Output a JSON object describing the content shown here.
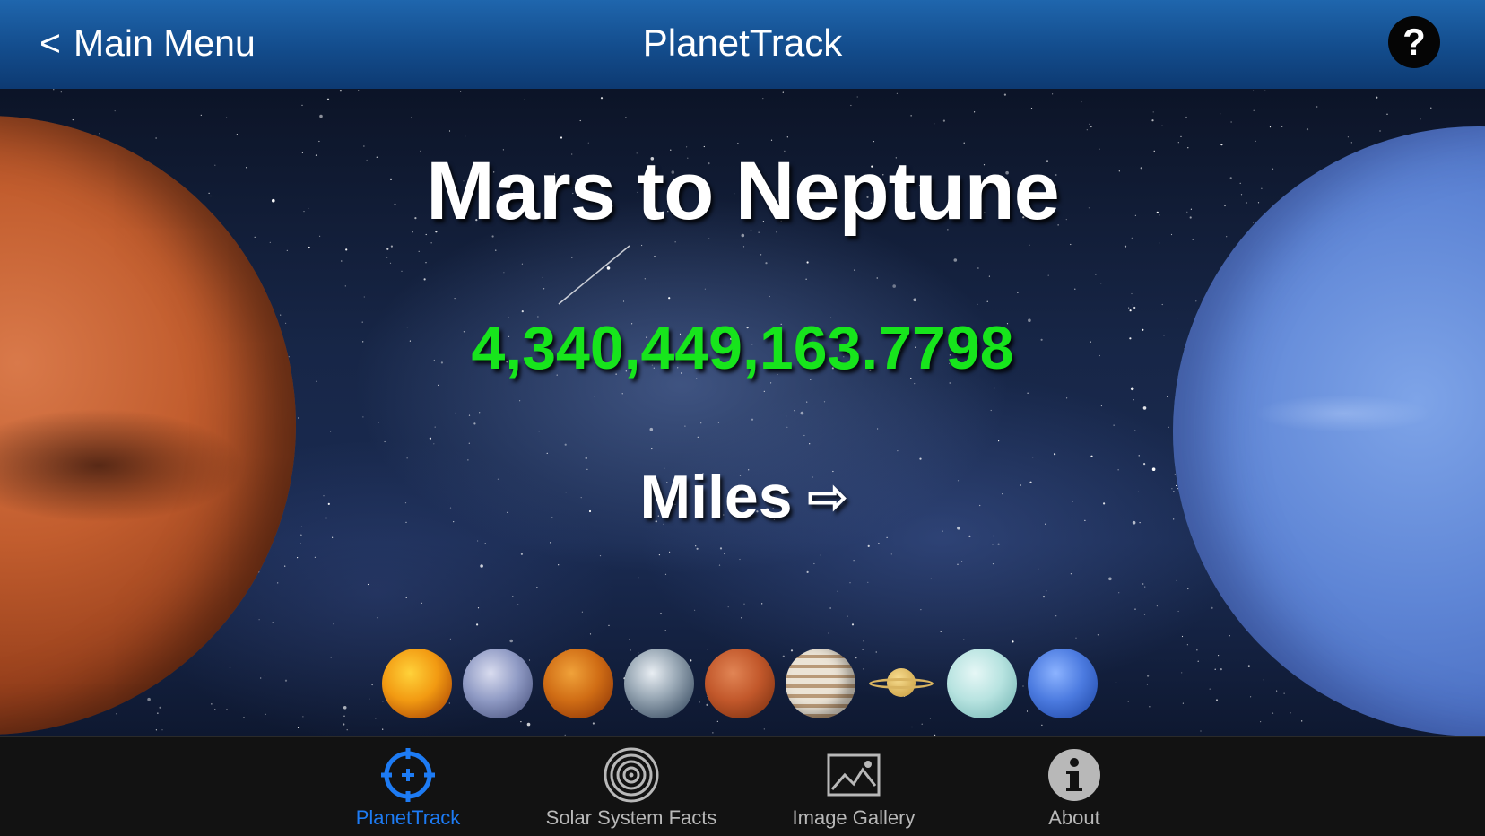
{
  "header": {
    "back_label": "Main Menu",
    "back_chevron": "<",
    "title": "PlanetTrack",
    "help_label": "?"
  },
  "main": {
    "route_title": "Mars to Neptune",
    "distance": "4,340,449,163.7798",
    "unit_label": "Miles",
    "unit_arrow": "⇨",
    "from_planet_icon": "mars-image",
    "to_planet_icon": "neptune-image",
    "planets": [
      "sun-icon",
      "mercury-icon",
      "venus-icon",
      "earth-icon",
      "mars-icon",
      "jupiter-icon",
      "saturn-icon",
      "uranus-icon",
      "neptune-icon"
    ]
  },
  "tabs": [
    {
      "label": "PlanetTrack",
      "icon": "crosshair-icon",
      "active": true
    },
    {
      "label": "Solar System Facts",
      "icon": "spiral-icon",
      "active": false
    },
    {
      "label": "Image Gallery",
      "icon": "image-gallery-icon",
      "active": false
    },
    {
      "label": "About",
      "icon": "info-icon",
      "active": false
    }
  ],
  "colors": {
    "header_blue": "#134c8c",
    "distance_green": "#17e51c",
    "active_tab_blue": "#1d7bf4",
    "tabbar_bg": "#121212"
  }
}
